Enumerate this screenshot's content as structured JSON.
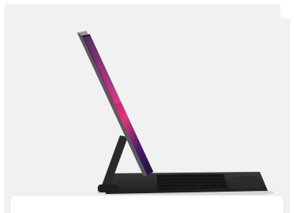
{
  "product": {
    "image_description": "ipad-pro-on-magic-keyboard",
    "icon": "product-photo",
    "colors": {
      "card_background": "#f1f1f1",
      "device_body": "#2a2a2c",
      "screen_gradient": [
        "#1b1030",
        "#a61f7a",
        "#e8327a"
      ],
      "panel_background": "#ffffff"
    }
  }
}
